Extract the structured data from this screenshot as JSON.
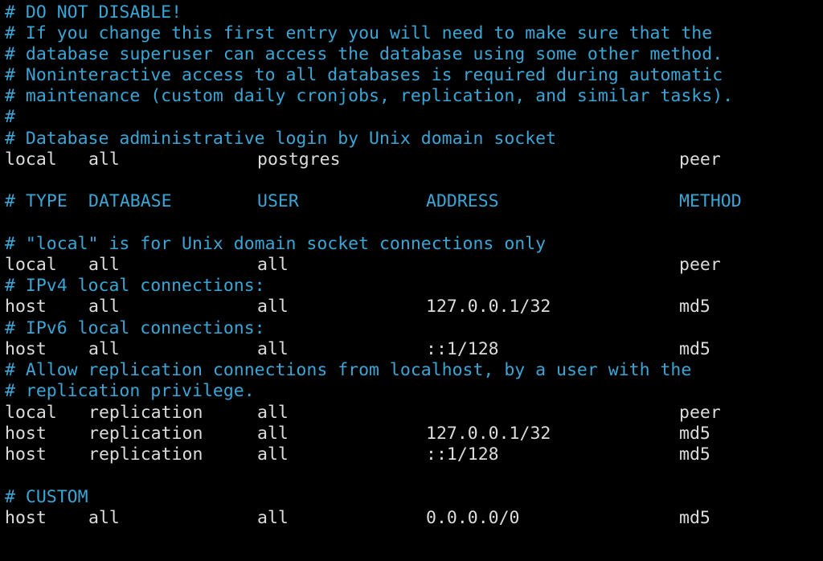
{
  "comments_top": [
    "# DO NOT DISABLE!",
    "# If you change this first entry you will need to make sure that the",
    "# database superuser can access the database using some other method.",
    "# Noninteractive access to all databases is required during automatic",
    "# maintenance (custom daily cronjobs, replication, and similar tasks).",
    "#",
    "# Database administrative login by Unix domain socket"
  ],
  "admin_entry": {
    "type": "local",
    "database": "all",
    "user": "postgres",
    "address": "",
    "method": "peer"
  },
  "header": {
    "hash": "#",
    "type": "TYPE",
    "database": "DATABASE",
    "user": "USER",
    "address": "ADDRESS",
    "method": "METHOD"
  },
  "comment_local": "# \"local\" is for Unix domain socket connections only",
  "local_entry": {
    "type": "local",
    "database": "all",
    "user": "all",
    "address": "",
    "method": "peer"
  },
  "comment_ipv4": "# IPv4 local connections:",
  "ipv4_entry": {
    "type": "host",
    "database": "all",
    "user": "all",
    "address": "127.0.0.1/32",
    "method": "md5"
  },
  "comment_ipv6": "# IPv6 local connections:",
  "ipv6_entry": {
    "type": "host",
    "database": "all",
    "user": "all",
    "address": "::1/128",
    "method": "md5"
  },
  "comment_replication": [
    "# Allow replication connections from localhost, by a user with the",
    "# replication privilege."
  ],
  "replication_entries": [
    {
      "type": "local",
      "database": "replication",
      "user": "all",
      "address": "",
      "method": "peer"
    },
    {
      "type": "host",
      "database": "replication",
      "user": "all",
      "address": "127.0.0.1/32",
      "method": "md5"
    },
    {
      "type": "host",
      "database": "replication",
      "user": "all",
      "address": "::1/128",
      "method": "md5"
    }
  ],
  "comment_custom": "# CUSTOM",
  "custom_entry": {
    "type": "host",
    "database": "all",
    "user": "all",
    "address": "0.0.0.0/0",
    "method": "md5"
  },
  "colors": {
    "background": "#000000",
    "comment": "#3aa6d6",
    "text": "#dcdcdc"
  }
}
